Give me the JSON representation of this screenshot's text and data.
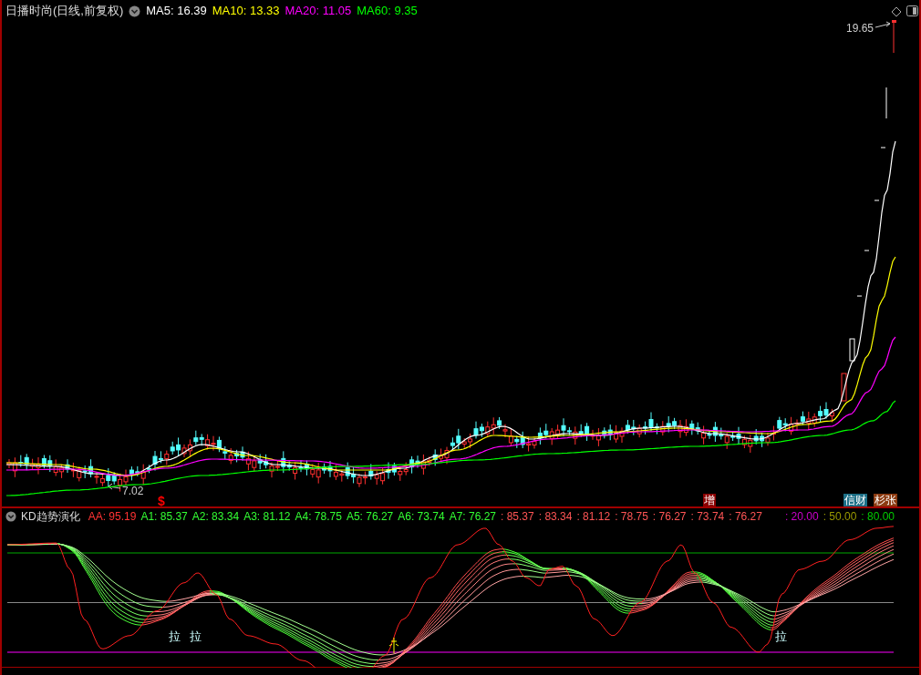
{
  "main_chart": {
    "title": "日播时尚(日线,前复权)",
    "moving_averages": [
      {
        "label": "MA5: 16.39",
        "color": "#ffffff"
      },
      {
        "label": "MA10: 13.33",
        "color": "#ffff00"
      },
      {
        "label": "MA20: 11.05",
        "color": "#ff00ff"
      },
      {
        "label": "MA60: 9.35",
        "color": "#00ff00"
      }
    ],
    "high_label": "19.65",
    "low_label": "7.02",
    "signals": [
      {
        "kind": "text",
        "text": "$",
        "color": "#ff0000"
      },
      {
        "kind": "tag",
        "text": "增",
        "color": "#8b0000"
      },
      {
        "kind": "tag",
        "text": "信财",
        "color": "#1c6f86"
      },
      {
        "kind": "tag",
        "text": "杉张",
        "color": "#8b3a10"
      }
    ]
  },
  "indicator_panel": {
    "title": "KD趋势演化",
    "values": [
      {
        "label": "AA: 95.19",
        "color": "#ff3333"
      },
      {
        "label": "A1: 85.37",
        "color": "#33ff33"
      },
      {
        "label": "A2: 83.34",
        "color": "#33ff33"
      },
      {
        "label": "A3: 81.12",
        "color": "#33ff33"
      },
      {
        "label": "A4: 78.75",
        "color": "#33ff33"
      },
      {
        "label": "A5: 76.27",
        "color": "#33ff33"
      },
      {
        "label": "A6: 73.74",
        "color": "#33ff33"
      },
      {
        "label": "A7: 76.27",
        "color": "#33ff33"
      },
      {
        "label": ": 85.37",
        "color": "#ff5555"
      },
      {
        "label": ": 83.34",
        "color": "#ff5555"
      },
      {
        "label": ": 81.12",
        "color": "#ff5555"
      },
      {
        "label": ": 78.75",
        "color": "#ff5555"
      },
      {
        "label": ": 76.27",
        "color": "#ff5555"
      },
      {
        "label": ": 73.74",
        "color": "#ff5555"
      },
      {
        "label": ": 76.27",
        "color": "#ff5555"
      },
      {
        "label": ": 20.00",
        "color": "#cc00cc"
      },
      {
        "label": ": 50.00",
        "color": "#999900"
      },
      {
        "label": ": 80.00",
        "color": "#00cc00"
      }
    ],
    "signals": [
      {
        "text": "拉"
      },
      {
        "text": "拉"
      },
      {
        "text": "拉"
      }
    ]
  }
}
